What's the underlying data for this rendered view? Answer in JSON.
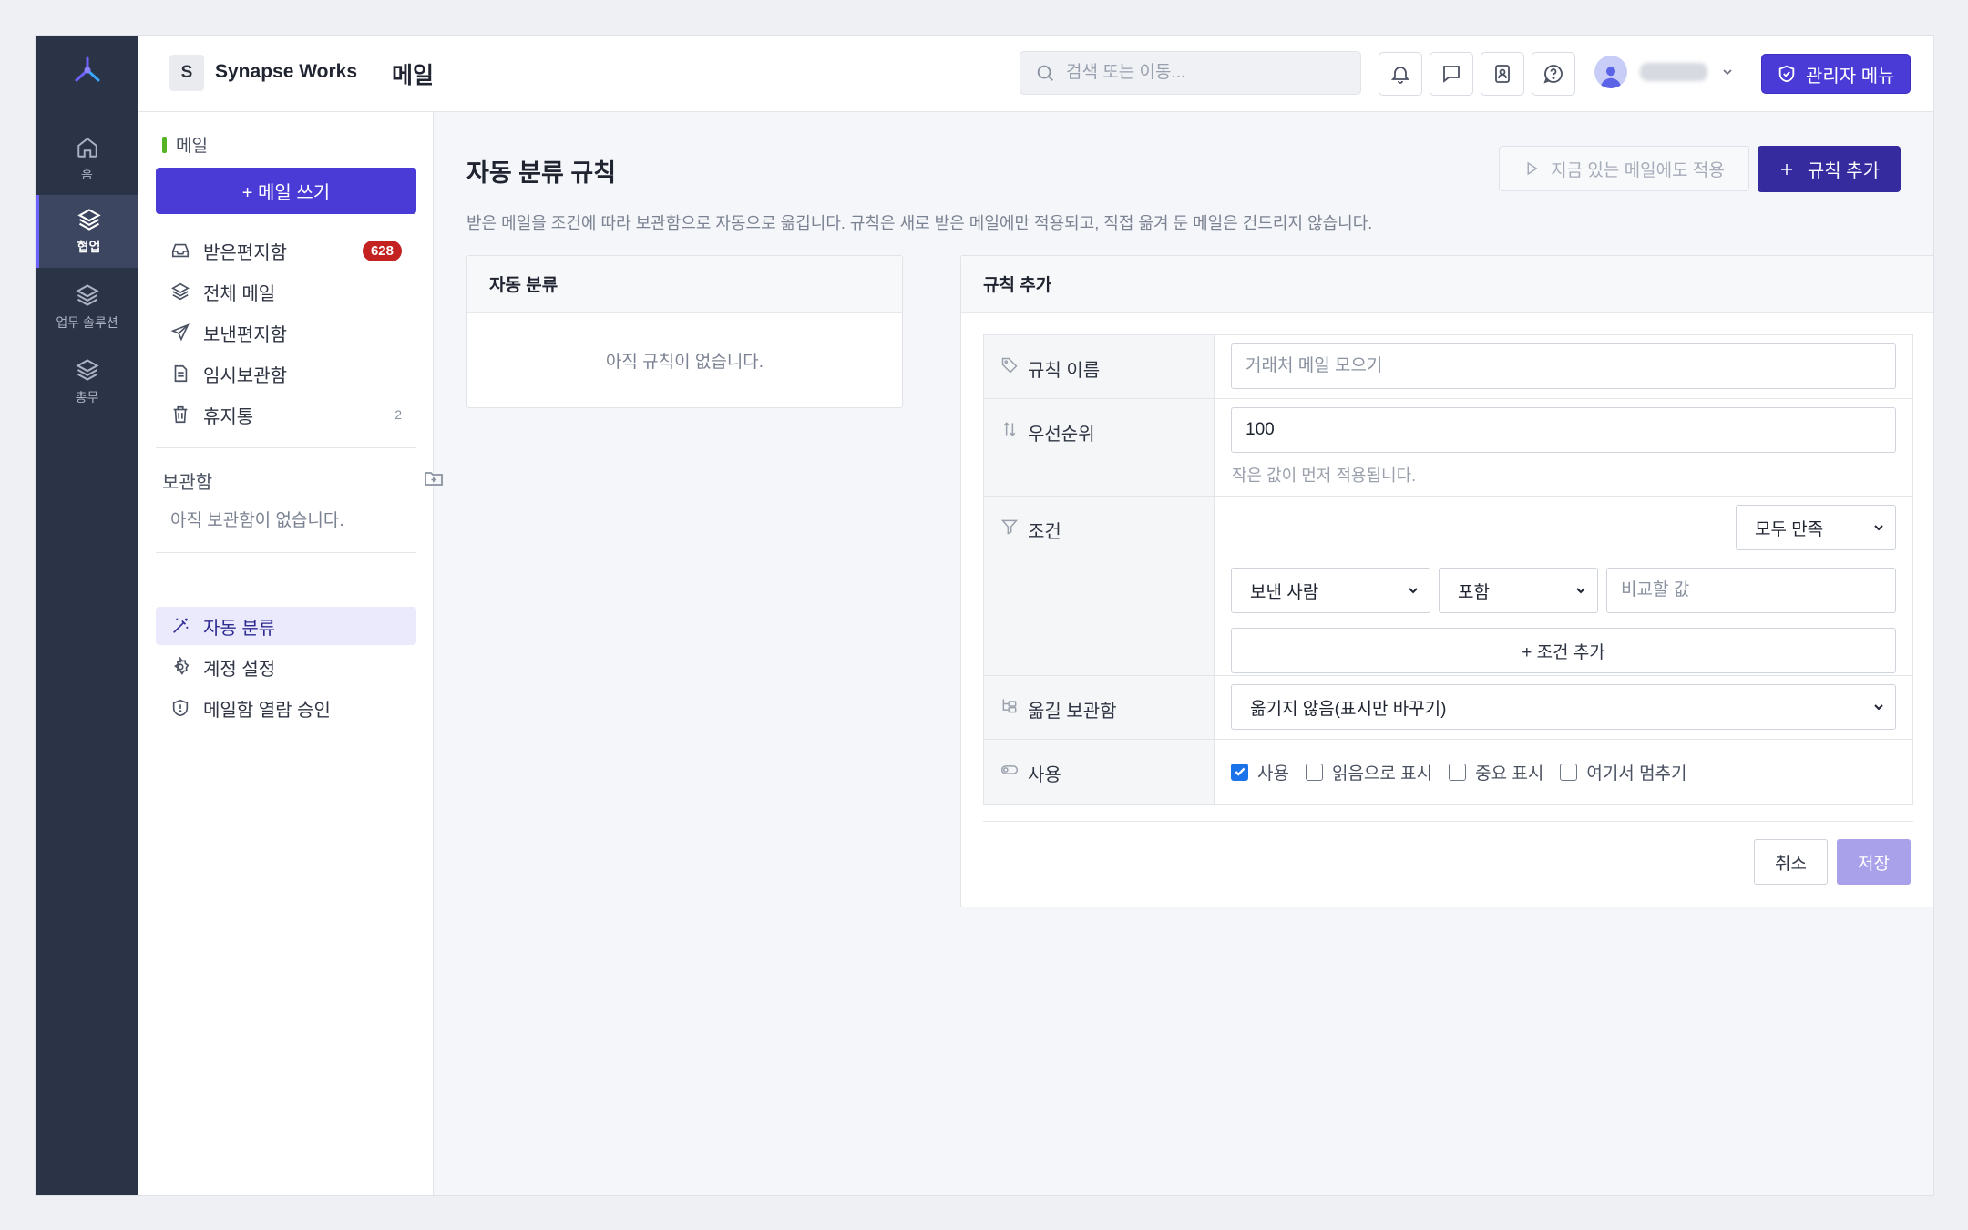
{
  "rail": {
    "items": [
      {
        "label": "홈",
        "icon": "home-icon"
      },
      {
        "label": "협업",
        "icon": "layers-icon",
        "active": true
      },
      {
        "label": "업무 솔루션",
        "icon": "layers-icon"
      },
      {
        "label": "총무",
        "icon": "layers-icon"
      }
    ]
  },
  "header": {
    "org_initial": "S",
    "org_name": "Synapse Works",
    "app_title": "메일",
    "search_placeholder": "검색 또는 이동...",
    "admin_label": "관리자 메뉴"
  },
  "leftnav": {
    "section_label": "메일",
    "compose_label": "+ 메일 쓰기",
    "mailboxes": [
      {
        "label": "받은편지함",
        "icon": "inbox-icon",
        "badge": "628"
      },
      {
        "label": "전체 메일",
        "icon": "layers-icon"
      },
      {
        "label": "보낸편지함",
        "icon": "send-icon"
      },
      {
        "label": "임시보관함",
        "icon": "document-icon"
      },
      {
        "label": "휴지통",
        "icon": "trash-icon",
        "count": "2"
      }
    ],
    "folders_title": "보관함",
    "folders_empty": "아직 보관함이 없습니다.",
    "settings": [
      {
        "label": "자동 분류",
        "icon": "magic-wand-icon",
        "active": true
      },
      {
        "label": "계정 설정",
        "icon": "gear-icon"
      },
      {
        "label": "메일함 열람 승인",
        "icon": "shield-alert-icon"
      }
    ]
  },
  "main": {
    "title": "자동 분류 규칙",
    "apply_label": "지금 있는 메일에도 적용",
    "add_rule_label": "규칙 추가",
    "description": "받은 메일을 조건에 따라 보관함으로 자동으로 옮깁니다. 규칙은 새로 받은 메일에만 적용되고, 직접 옮겨 둔 메일은 건드리지 않습니다.",
    "rules_card": {
      "title": "자동 분류",
      "empty": "아직 규칙이 없습니다."
    },
    "form_card": {
      "title": "규칙 추가",
      "name_label": "규칙 이름",
      "name_placeholder": "거래처 메일 모으기",
      "priority_label": "우선순위",
      "priority_value": "100",
      "priority_hint": "작은 값이 먼저 적용됩니다.",
      "condition_label": "조건",
      "match_mode": "모두 만족",
      "cond_field": "보낸 사람",
      "cond_op": "포함",
      "cond_value_placeholder": "비교할 값",
      "add_condition_label": "+ 조건 추가",
      "target_label": "옮길 보관함",
      "target_value": "옮기지 않음(표시만 바꾸기)",
      "enable_label": "사용",
      "options": [
        {
          "label": "사용",
          "checked": true
        },
        {
          "label": "읽음으로 표시",
          "checked": false
        },
        {
          "label": "중요 표시",
          "checked": false
        },
        {
          "label": "여기서 멈추기",
          "checked": false
        }
      ],
      "cancel_label": "취소",
      "save_label": "저장"
    }
  },
  "colors": {
    "accent": "#4a3ad6",
    "rail": "#2b3346",
    "badge": "#c42121",
    "save_disabled": "#a9a2ea"
  }
}
